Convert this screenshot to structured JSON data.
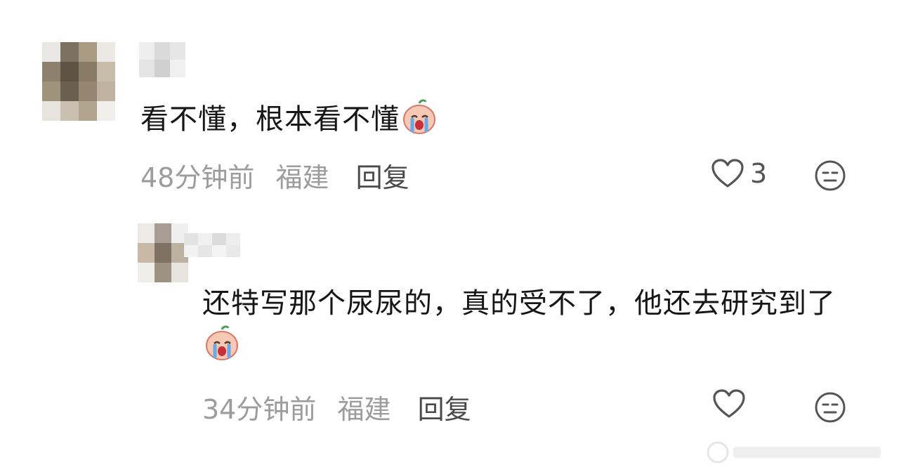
{
  "comments": [
    {
      "text": "看不懂，根本看不懂",
      "time": "48分钟前",
      "location": "福建",
      "reply_label": "回复",
      "like_count": "3",
      "emoji_icon": "crying-face-emoji-icon"
    },
    {
      "text": "还特写那个尿尿的，真的受不了，他还去研究到了",
      "time": "34分钟前",
      "location": "福建",
      "reply_label": "回复",
      "like_count": "",
      "emoji_icon": "crying-face-emoji-icon"
    }
  ],
  "icons": {
    "like": "heart-outline-icon",
    "dislike": "meh-face-icon"
  },
  "colors": {
    "text_primary": "#161616",
    "text_meta": "#9c9c9c",
    "reply": "#4a4a4a",
    "icon": "#555555"
  }
}
